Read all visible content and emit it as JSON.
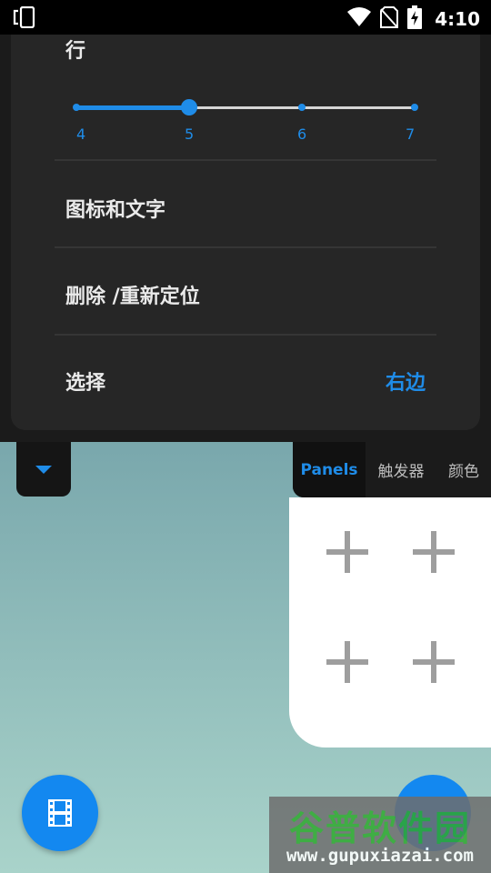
{
  "status_bar": {
    "time": "4:10",
    "icons": [
      "screen-rotate-icon",
      "wifi-icon",
      "no-sim-icon",
      "battery-charging-icon"
    ]
  },
  "settings_sheet": {
    "rows_label": "行",
    "slider": {
      "ticks": [
        "4",
        "5",
        "6",
        "7"
      ],
      "value": 5,
      "min": 4,
      "max": 7,
      "accent": "#1f8ce8"
    },
    "items": [
      {
        "label": "图标和文字",
        "value": ""
      },
      {
        "label": "删除 /重新定位",
        "value": ""
      },
      {
        "label": "选择",
        "value": "右边"
      }
    ]
  },
  "tabs": [
    {
      "label": "Panels",
      "active": true
    },
    {
      "label": "触发器",
      "active": false
    },
    {
      "label": "颜色",
      "active": false
    }
  ],
  "panel_slots": [
    "add-slot",
    "add-slot",
    "add-slot",
    "add-slot"
  ],
  "watermark": {
    "title": "谷普软件园",
    "url": "www.gupuxiazai.com"
  }
}
